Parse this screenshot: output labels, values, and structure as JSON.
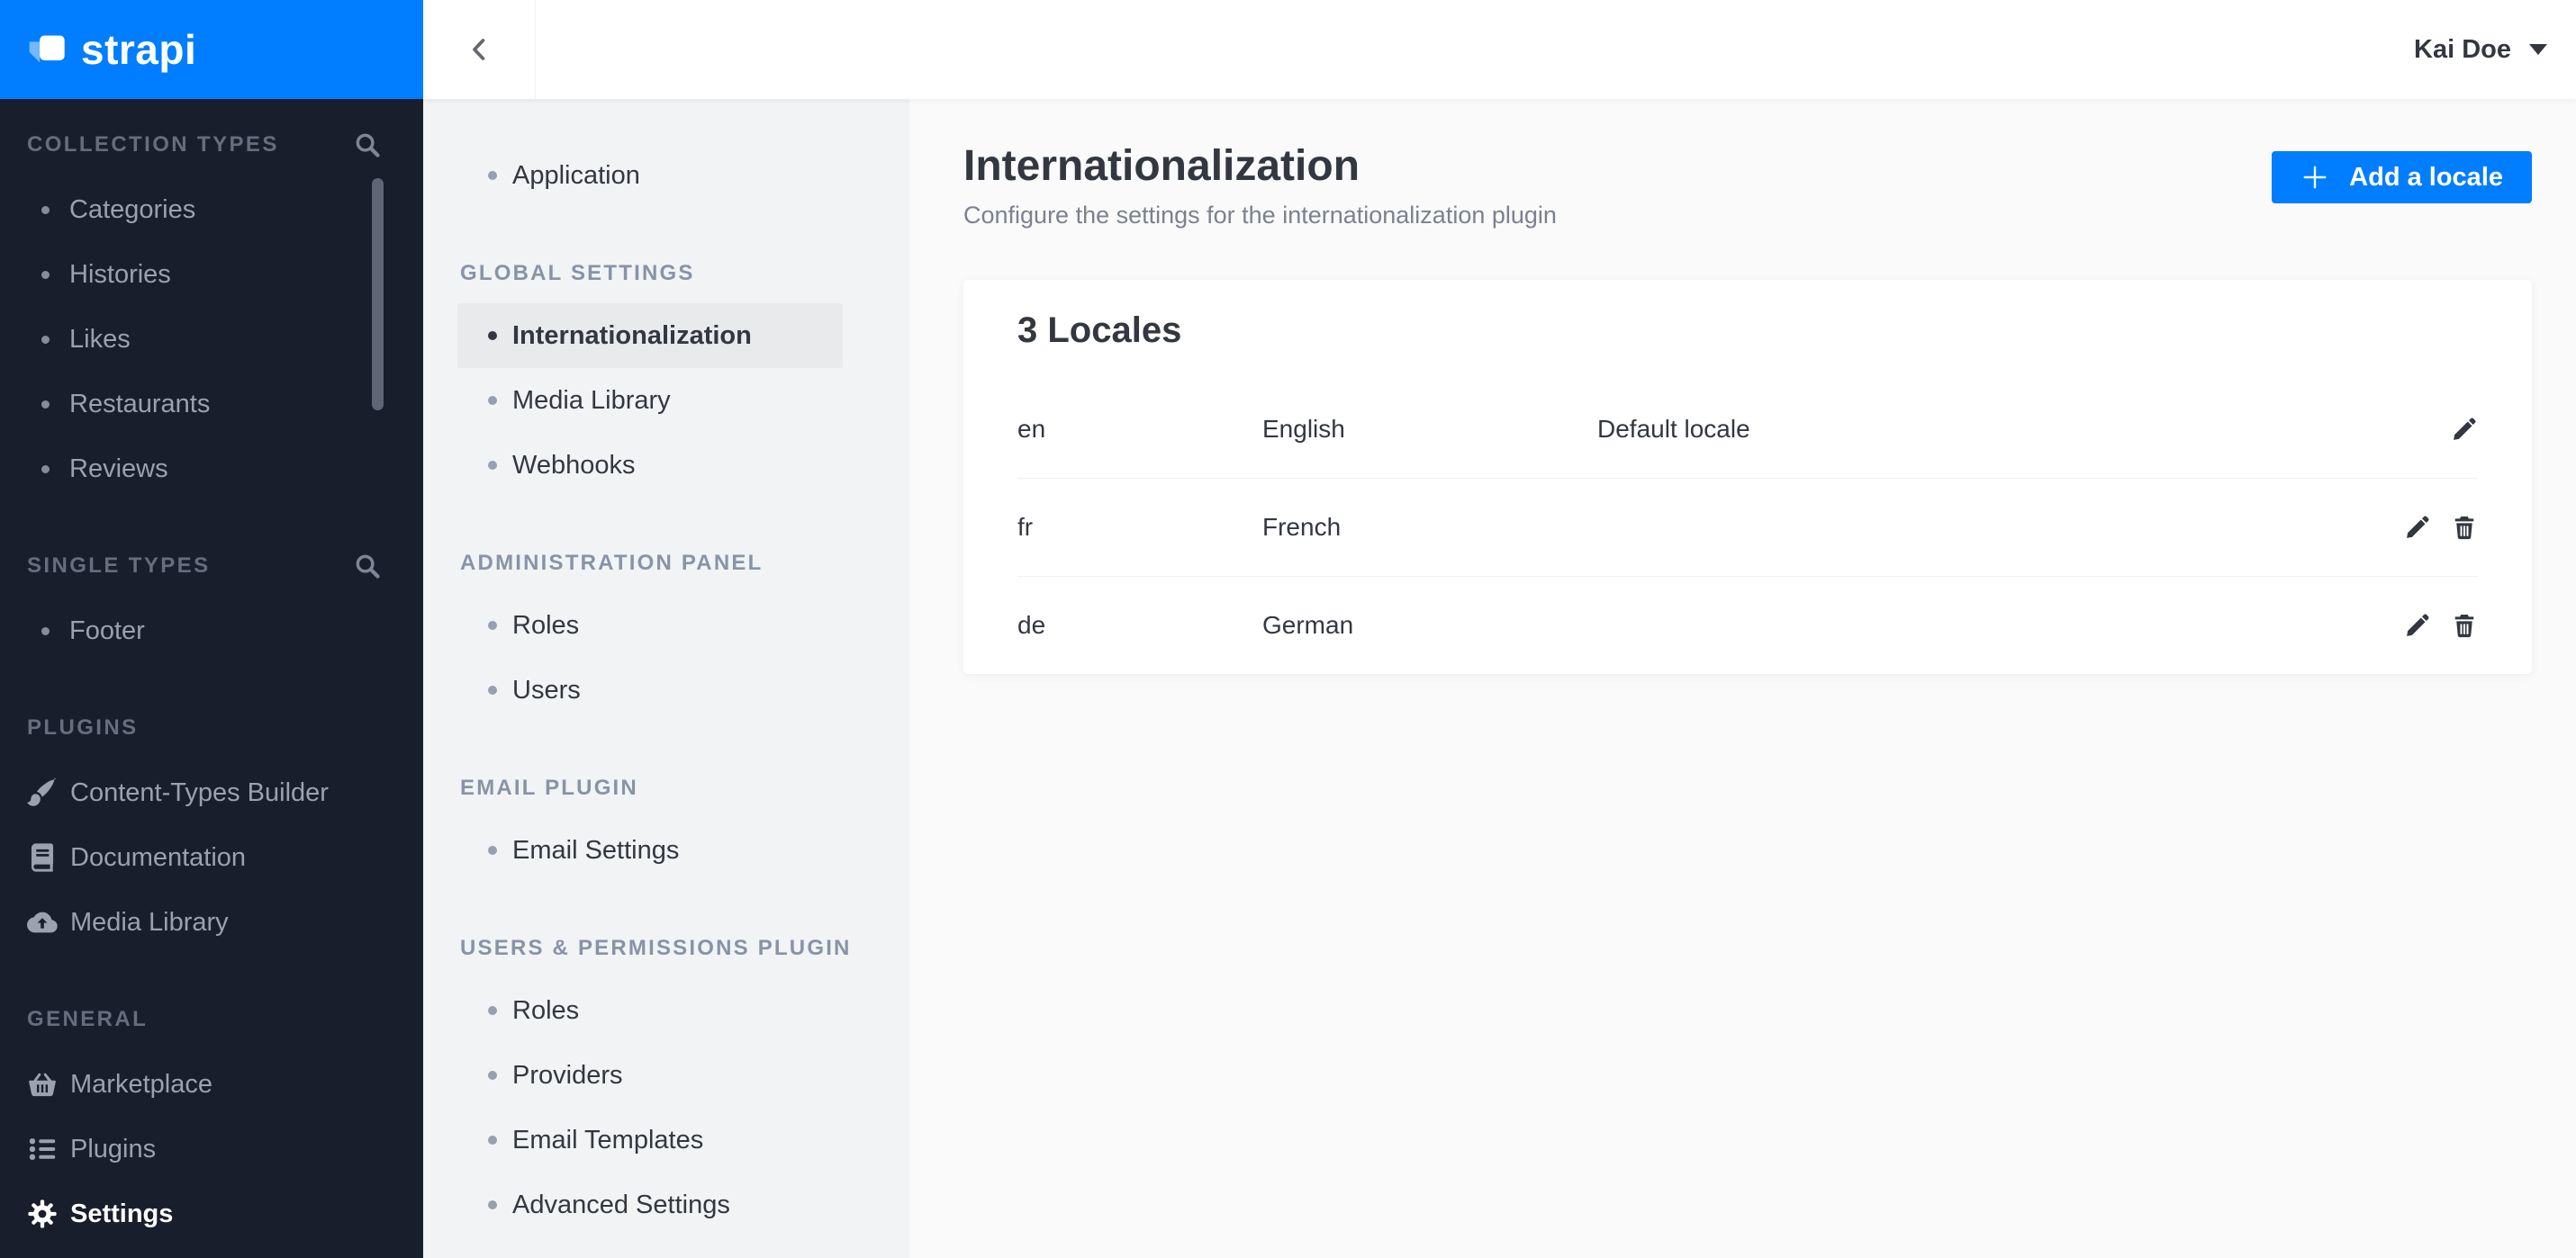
{
  "brand": {
    "name": "strapi",
    "logo_icon": "strapi-logo-icon"
  },
  "top_bar": {
    "back_icon": "chevron-left-icon",
    "user": {
      "name": "Kai Doe",
      "caret_icon": "caret-down-icon"
    }
  },
  "left_sidebar": {
    "sections": [
      {
        "title": "Collection Types",
        "has_search": true,
        "items": [
          {
            "label": "Categories",
            "icon": "bullet"
          },
          {
            "label": "Histories",
            "icon": "bullet"
          },
          {
            "label": "Likes",
            "icon": "bullet"
          },
          {
            "label": "Restaurants",
            "icon": "bullet"
          },
          {
            "label": "Reviews",
            "icon": "bullet"
          }
        ]
      },
      {
        "title": "Single Types",
        "has_search": true,
        "items": [
          {
            "label": "Footer",
            "icon": "bullet"
          }
        ]
      },
      {
        "title": "Plugins",
        "has_search": false,
        "items": [
          {
            "label": "Content-Types Builder",
            "icon": "paintbrush-icon"
          },
          {
            "label": "Documentation",
            "icon": "book-icon"
          },
          {
            "label": "Media Library",
            "icon": "cloud-upload-icon"
          }
        ]
      },
      {
        "title": "General",
        "has_search": false,
        "items": [
          {
            "label": "Marketplace",
            "icon": "basket-icon"
          },
          {
            "label": "Plugins",
            "icon": "list-icon"
          },
          {
            "label": "Settings",
            "icon": "gear-icon",
            "active": true
          }
        ]
      }
    ]
  },
  "settings_nav": {
    "sections": [
      {
        "title": "",
        "items": [
          {
            "label": "Application"
          }
        ]
      },
      {
        "title": "Global Settings",
        "items": [
          {
            "label": "Internationalization",
            "active": true
          },
          {
            "label": "Media Library"
          },
          {
            "label": "Webhooks"
          }
        ]
      },
      {
        "title": "Administration Panel",
        "items": [
          {
            "label": "Roles"
          },
          {
            "label": "Users"
          }
        ]
      },
      {
        "title": "Email Plugin",
        "items": [
          {
            "label": "Email Settings"
          }
        ]
      },
      {
        "title": "Users & Permissions Plugin",
        "items": [
          {
            "label": "Roles"
          },
          {
            "label": "Providers"
          },
          {
            "label": "Email Templates"
          },
          {
            "label": "Advanced Settings"
          }
        ]
      }
    ]
  },
  "page": {
    "title": "Internationalization",
    "subtitle": "Configure the settings for the internationalization plugin",
    "add_button": {
      "label": "Add a locale",
      "icon": "plus-icon"
    }
  },
  "locales_card": {
    "title": "3 Locales",
    "rows": [
      {
        "code": "en",
        "name": "English",
        "note": "Default locale",
        "actions": [
          "edit"
        ]
      },
      {
        "code": "fr",
        "name": "French",
        "note": "",
        "actions": [
          "edit",
          "delete"
        ]
      },
      {
        "code": "de",
        "name": "German",
        "note": "",
        "actions": [
          "edit",
          "delete"
        ]
      }
    ]
  },
  "colors": {
    "accent": "#007eff",
    "sidebar_bg": "#181e2c",
    "settings_col_bg": "#f2f3f4",
    "active_item_bg": "#e9eaeb",
    "main_bg": "#fafafb",
    "text_dark": "#333740",
    "text_muted": "#7b818f",
    "separator": "#f0f1f2"
  }
}
